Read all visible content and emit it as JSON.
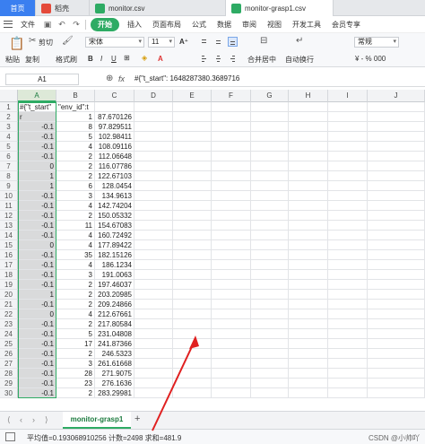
{
  "tabs": [
    {
      "label": "首页",
      "icon": "home-icon"
    },
    {
      "label": "稻壳",
      "icon": "daoke-icon"
    },
    {
      "label": "monitor.csv",
      "icon": "sheet-icon"
    },
    {
      "label": "monitor-grasp1.csv",
      "icon": "sheet-icon"
    }
  ],
  "menu": {
    "file": "文件",
    "start": "开始",
    "items": [
      "插入",
      "页面布局",
      "公式",
      "数据",
      "审阅",
      "视图",
      "开发工具",
      "会员专享"
    ]
  },
  "ribbon": {
    "cut": "剪切",
    "paste": "粘贴",
    "copy": "复制",
    "format_painter": "格式刷",
    "font": "宋体",
    "font_size": "11",
    "merge_center": "合并居中",
    "wrap_text": "自动换行",
    "number_format": "常规"
  },
  "formula_bar": {
    "cell_ref": "A1",
    "fx": "fx",
    "formula": "#{\"t_start\": 1648287380.3689716"
  },
  "columns": [
    "A",
    "B",
    "C",
    "D",
    "E",
    "F",
    "G",
    "H",
    "I",
    "J"
  ],
  "rows": [
    {
      "n": "1",
      "a": "#{\"t_start\"",
      "b": "\"env_id\":t",
      "c": ""
    },
    {
      "n": "2",
      "a": "r",
      "b": "1",
      "c": "87.670126"
    },
    {
      "n": "3",
      "a": "-0.1",
      "b": "8",
      "c": "97.829511"
    },
    {
      "n": "4",
      "a": "-0.1",
      "b": "5",
      "c": "102.98411"
    },
    {
      "n": "5",
      "a": "-0.1",
      "b": "4",
      "c": "108.09116"
    },
    {
      "n": "6",
      "a": "-0.1",
      "b": "2",
      "c": "112.06648"
    },
    {
      "n": "7",
      "a": "0",
      "b": "2",
      "c": "116.07786"
    },
    {
      "n": "8",
      "a": "1",
      "b": "2",
      "c": "122.67103"
    },
    {
      "n": "9",
      "a": "1",
      "b": "6",
      "c": "128.0454"
    },
    {
      "n": "10",
      "a": "-0.1",
      "b": "3",
      "c": "134.9613"
    },
    {
      "n": "11",
      "a": "-0.1",
      "b": "4",
      "c": "142.74204"
    },
    {
      "n": "12",
      "a": "-0.1",
      "b": "2",
      "c": "150.05332"
    },
    {
      "n": "13",
      "a": "-0.1",
      "b": "11",
      "c": "154.67083"
    },
    {
      "n": "14",
      "a": "-0.1",
      "b": "4",
      "c": "160.72492"
    },
    {
      "n": "15",
      "a": "0",
      "b": "4",
      "c": "177.89422"
    },
    {
      "n": "16",
      "a": "-0.1",
      "b": "35",
      "c": "182.15126"
    },
    {
      "n": "17",
      "a": "-0.1",
      "b": "4",
      "c": "186.1234"
    },
    {
      "n": "18",
      "a": "-0.1",
      "b": "3",
      "c": "191.0063"
    },
    {
      "n": "19",
      "a": "-0.1",
      "b": "2",
      "c": "197.46037"
    },
    {
      "n": "20",
      "a": "1",
      "b": "2",
      "c": "203.20985"
    },
    {
      "n": "21",
      "a": "-0.1",
      "b": "2",
      "c": "209.24866"
    },
    {
      "n": "22",
      "a": "0",
      "b": "4",
      "c": "212.67661"
    },
    {
      "n": "23",
      "a": "-0.1",
      "b": "2",
      "c": "217.80584"
    },
    {
      "n": "24",
      "a": "-0.1",
      "b": "5",
      "c": "231.04808"
    },
    {
      "n": "25",
      "a": "-0.1",
      "b": "17",
      "c": "241.87366"
    },
    {
      "n": "26",
      "a": "-0.1",
      "b": "2",
      "c": "246.5323"
    },
    {
      "n": "27",
      "a": "-0.1",
      "b": "3",
      "c": "261.61668"
    },
    {
      "n": "28",
      "a": "-0.1",
      "b": "28",
      "c": "271.9075"
    },
    {
      "n": "29",
      "a": "-0.1",
      "b": "23",
      "c": "276.1636"
    },
    {
      "n": "30",
      "a": "-0.1",
      "b": "2",
      "c": "283.29981"
    }
  ],
  "sheet_bar": {
    "sheet_name": "monitor-grasp1",
    "add": "+"
  },
  "status_bar": {
    "text": "平均值=0.193068910256  计数=2498  求和=481.9",
    "watermark": "CSDN @小帅吖"
  },
  "colors": {
    "accent_green": "#2eab64",
    "home_tab_blue": "#3a7ff0",
    "arrow_red": "#e02020"
  }
}
